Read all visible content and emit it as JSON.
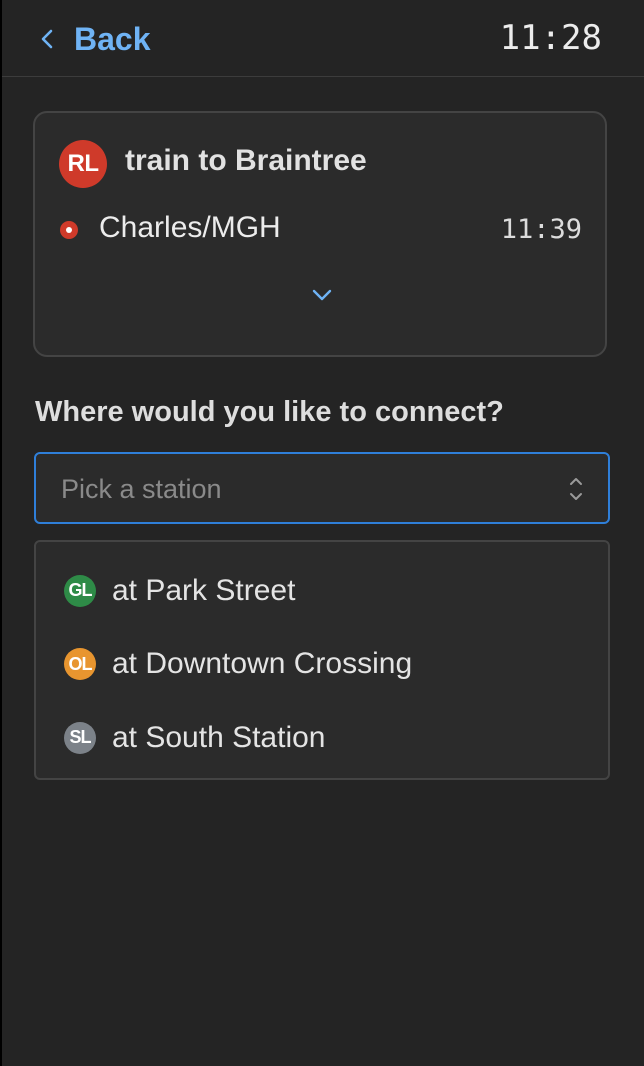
{
  "header": {
    "back_label": "Back",
    "time": "11:28",
    "icons": {
      "back": "chevron-left-icon"
    },
    "accent_color": "#6fb3f5"
  },
  "trip": {
    "route_badge": "RL",
    "route_color": "#cf3a2a",
    "title": "train to Braintree",
    "stop": {
      "name": "Charles/MGH",
      "time": "11:39"
    },
    "icons": {
      "expand": "chevron-down-icon"
    }
  },
  "connect": {
    "question": "Where would you like to connect?",
    "select": {
      "placeholder": "Pick a station",
      "icon": "chevron-up-down-icon",
      "border_color": "#2f7fd9"
    },
    "suggestions": [
      {
        "badge": "GL",
        "color": "#2e8b47",
        "label": "at Park Street"
      },
      {
        "badge": "OL",
        "color": "#e8952f",
        "label": "at Downtown Crossing"
      },
      {
        "badge": "SL",
        "color": "#7c8289",
        "label": "at South Station"
      }
    ]
  }
}
